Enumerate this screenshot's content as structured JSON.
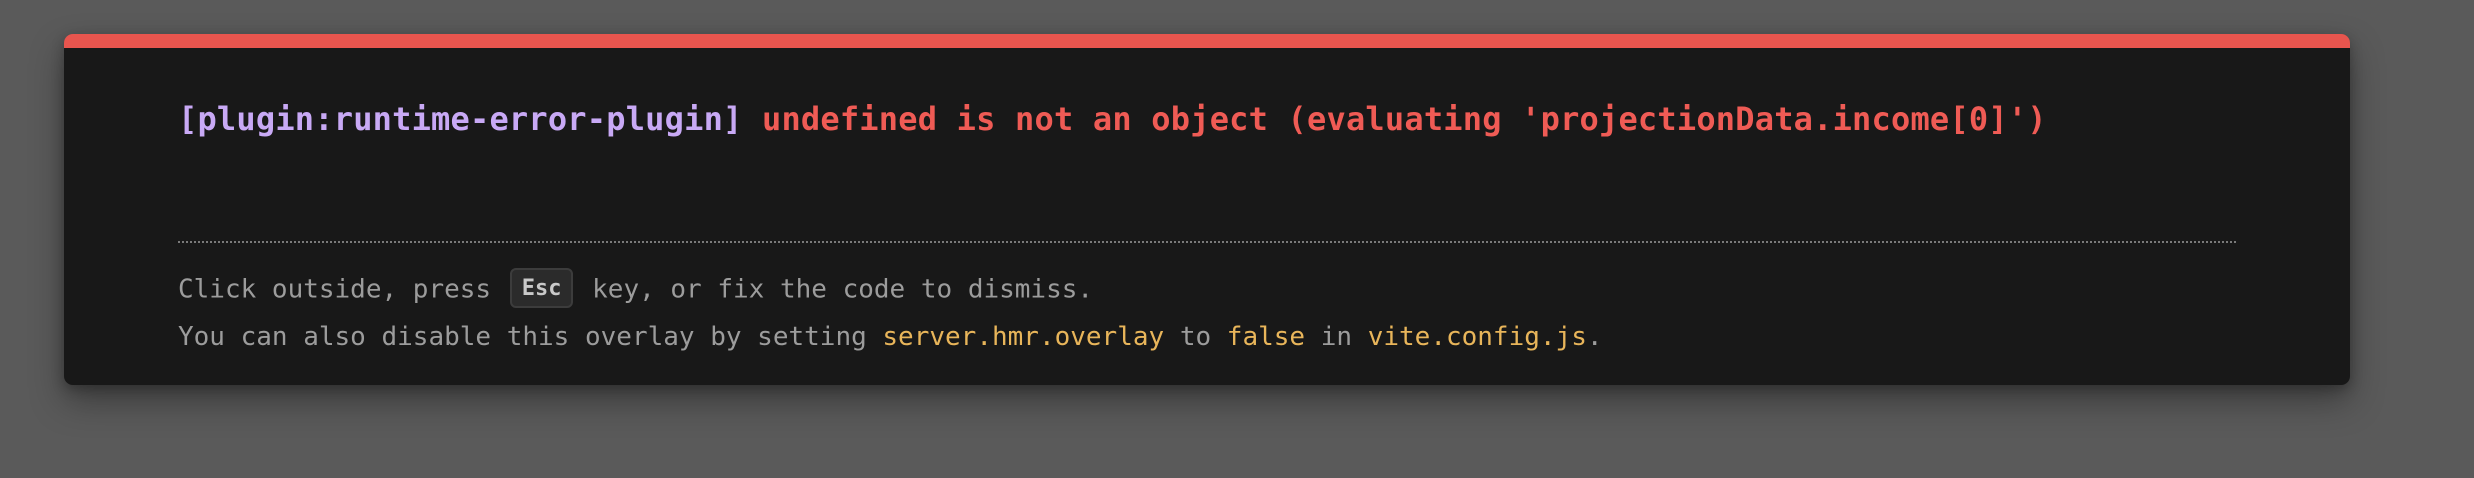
{
  "error": {
    "plugin_label": "[plugin:runtime-error-plugin]",
    "message": "undefined is not an object (evaluating 'projectionData.income[0]')"
  },
  "tip": {
    "line1_before": "Click outside, press ",
    "key": "Esc",
    "line1_after": " key, or fix the code to dismiss.",
    "line2_before": "You can also disable this overlay by setting ",
    "config_option": "server.hmr.overlay",
    "line2_mid1": " to ",
    "value": "false",
    "line2_mid2": " in ",
    "config_file": "vite.config.js",
    "line2_after": "."
  },
  "colors": {
    "accent_bar": "#e8554e",
    "plugin": "#c8a9f5",
    "error": "#ef5b55",
    "code": "#e8b55a",
    "tip_text": "#9c9c9c",
    "panel_bg": "#181818",
    "backdrop": "#5a5a5a"
  }
}
